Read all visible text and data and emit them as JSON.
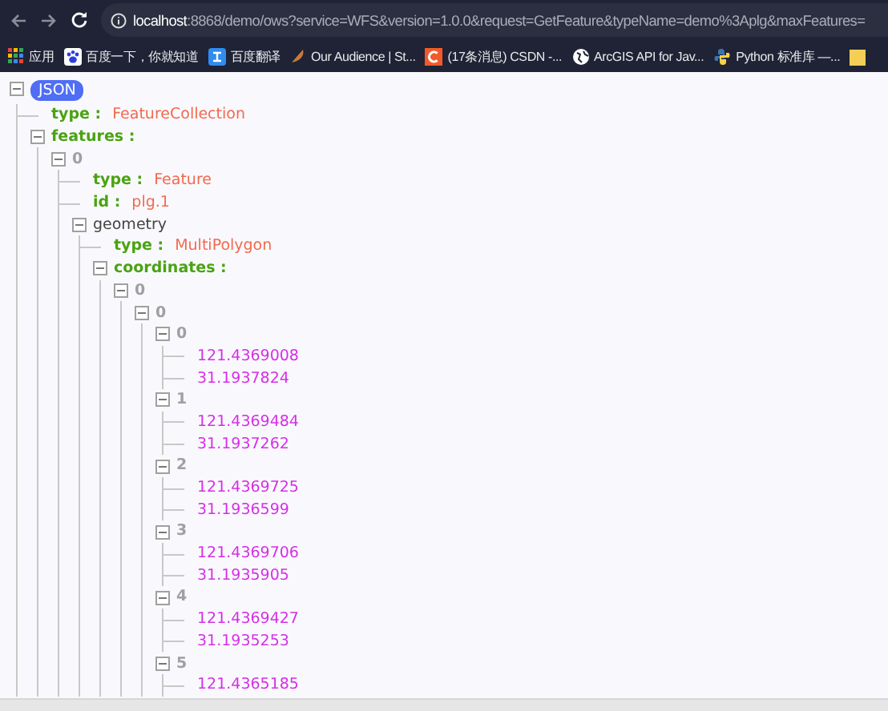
{
  "browser": {
    "address": {
      "host": "localhost",
      "rest": ":8868/demo/ows?service=WFS&version=1.0.0&request=GetFeature&typeName=demo%3Aplg&maxFeatures="
    },
    "bookmarks": [
      {
        "kind": "apps",
        "label": "应用"
      },
      {
        "kind": "paw",
        "label": "百度一下，你就知道"
      },
      {
        "kind": "translate",
        "label": "百度翻译"
      },
      {
        "kind": "audience",
        "label": "Our Audience | St..."
      },
      {
        "kind": "csdn",
        "label": "(17条消息) CSDN -..."
      },
      {
        "kind": "globe",
        "label": "ArcGIS API for Jav..."
      },
      {
        "kind": "python",
        "label": "Python 标准库 —..."
      },
      {
        "kind": "folder"
      }
    ]
  },
  "tree": {
    "kind": "root",
    "label": "JSON",
    "expanded": true,
    "children": [
      {
        "kind": "pair",
        "key": "type :",
        "value": "FeatureCollection"
      },
      {
        "kind": "array",
        "key": "features :",
        "expanded": true,
        "children": [
          {
            "kind": "index",
            "key": "0",
            "expanded": true,
            "children": [
              {
                "kind": "pair",
                "key": "type :",
                "value": "Feature"
              },
              {
                "kind": "pair",
                "key": "id :",
                "value": "plg.1"
              },
              {
                "kind": "object",
                "key": "geometry",
                "expanded": true,
                "children": [
                  {
                    "kind": "pair",
                    "key": "type :",
                    "value": "MultiPolygon"
                  },
                  {
                    "kind": "array",
                    "key": "coordinates :",
                    "expanded": true,
                    "children": [
                      {
                        "kind": "index",
                        "key": "0",
                        "expanded": true,
                        "children": [
                          {
                            "kind": "index",
                            "key": "0",
                            "expanded": true,
                            "children": [
                              {
                                "kind": "index",
                                "key": "0",
                                "expanded": true,
                                "children": [
                                  {
                                    "kind": "number",
                                    "value": "121.4369008"
                                  },
                                  {
                                    "kind": "number",
                                    "value": "31.1937824"
                                  }
                                ]
                              },
                              {
                                "kind": "index",
                                "key": "1",
                                "expanded": true,
                                "children": [
                                  {
                                    "kind": "number",
                                    "value": "121.4369484"
                                  },
                                  {
                                    "kind": "number",
                                    "value": "31.1937262"
                                  }
                                ]
                              },
                              {
                                "kind": "index",
                                "key": "2",
                                "expanded": true,
                                "children": [
                                  {
                                    "kind": "number",
                                    "value": "121.4369725"
                                  },
                                  {
                                    "kind": "number",
                                    "value": "31.1936599"
                                  }
                                ]
                              },
                              {
                                "kind": "index",
                                "key": "3",
                                "expanded": true,
                                "children": [
                                  {
                                    "kind": "number",
                                    "value": "121.4369706"
                                  },
                                  {
                                    "kind": "number",
                                    "value": "31.1935905"
                                  }
                                ]
                              },
                              {
                                "kind": "index",
                                "key": "4",
                                "expanded": true,
                                "children": [
                                  {
                                    "kind": "number",
                                    "value": "121.4369427"
                                  },
                                  {
                                    "kind": "number",
                                    "value": "31.1935253"
                                  }
                                ]
                              },
                              {
                                "kind": "index",
                                "key": "5",
                                "expanded": true,
                                "children": [
                                  {
                                    "kind": "number",
                                    "value": "121.4365185"
                                  }
                                ]
                              }
                            ]
                          }
                        ]
                      }
                    ]
                  }
                ]
              }
            ]
          }
        ]
      }
    ]
  }
}
